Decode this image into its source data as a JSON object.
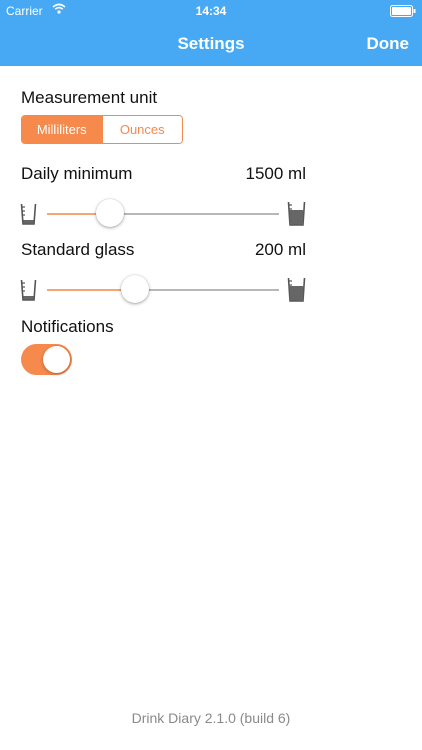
{
  "status_bar": {
    "carrier": "Carrier",
    "time": "14:34"
  },
  "nav": {
    "title": "Settings",
    "done_label": "Done"
  },
  "measurement": {
    "label": "Measurement unit",
    "options": [
      "Milliliters",
      "Ounces"
    ],
    "selected": "Milliliters"
  },
  "daily_minimum": {
    "label": "Daily minimum",
    "value": "1500 ml",
    "slider_fraction": 0.27
  },
  "standard_glass": {
    "label": "Standard glass",
    "value": "200 ml",
    "slider_fraction": 0.38
  },
  "notifications": {
    "label": "Notifications",
    "enabled": true
  },
  "footer": {
    "version": "Drink Diary 2.1.0 (build 6)"
  },
  "colors": {
    "nav_bar": "#47a9f3",
    "accent": "#f6894c"
  },
  "icons": [
    "wifi-icon",
    "battery-icon",
    "empty-glass-icon",
    "full-glass-icon"
  ]
}
